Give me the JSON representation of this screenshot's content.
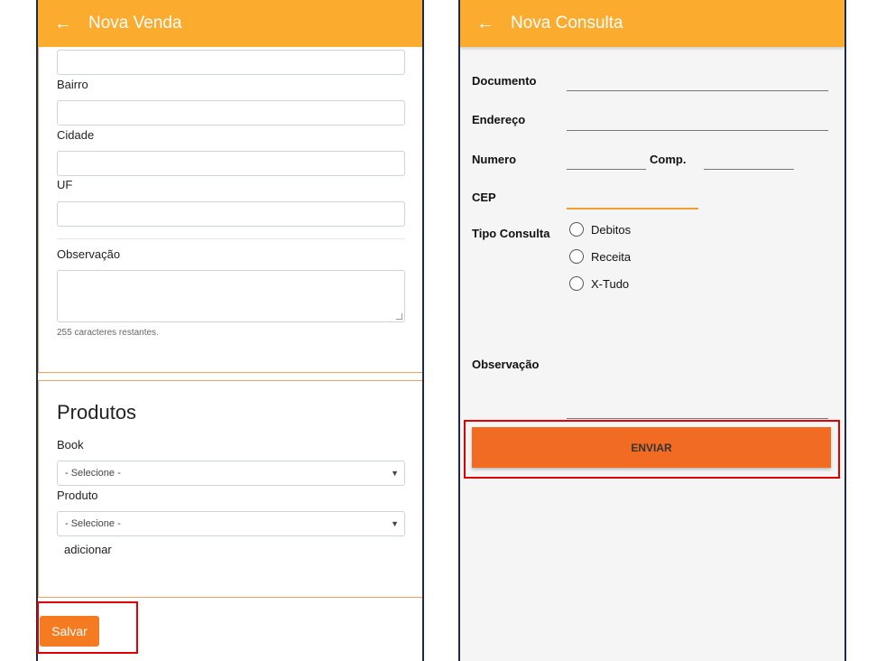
{
  "left": {
    "appbar": {
      "back_icon": "arrow-left-icon",
      "title": "Nova Venda"
    },
    "fields": {
      "bairro_label": "Bairro",
      "cidade_label": "Cidade",
      "uf_label": "UF",
      "observacao_label": "Observação",
      "chars_left": "255 caracteres restantes."
    },
    "produtos": {
      "title": "Produtos",
      "book_label": "Book",
      "book_select": "- Selecione -",
      "produto_label": "Produto",
      "produto_select": "- Selecione -",
      "add_link": "adicionar"
    },
    "salvar_label": "Salvar"
  },
  "right": {
    "appbar": {
      "back_icon": "arrow-left-icon",
      "title": "Nova Consulta"
    },
    "labels": {
      "documento": "Documento",
      "endereco": "Endereço",
      "numero": "Numero",
      "comp": "Comp.",
      "cep": "CEP",
      "tipo_consulta": "Tipo Consulta",
      "observacao": "Observação"
    },
    "radios": [
      "Debitos",
      "Receita",
      "X-Tudo"
    ],
    "enviar_label": "ENVIAR"
  },
  "colors": {
    "appbar": "#fbab2e",
    "button": "#f47b20",
    "highlight": "#e00000"
  }
}
